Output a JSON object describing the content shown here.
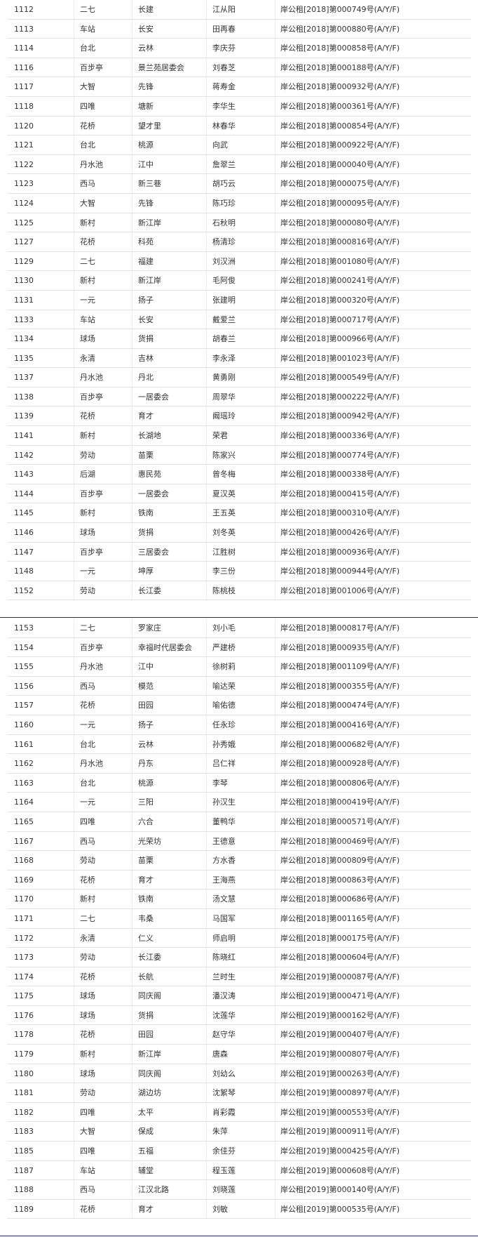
{
  "table_top": {
    "rows": [
      [
        "1112",
        "二七",
        "长建",
        "江从阳",
        "岸公租[2018]第000749号(A/Y/F)"
      ],
      [
        "1113",
        "车站",
        "长安",
        "田再春",
        "岸公租[2018]第000880号(A/Y/F)"
      ],
      [
        "1114",
        "台北",
        "云林",
        "李庆芬",
        "岸公租[2018]第000858号(A/Y/F)"
      ],
      [
        "1116",
        "百步亭",
        "景兰苑居委会",
        "刘春芝",
        "岸公租[2018]第000188号(A/Y/F)"
      ],
      [
        "1117",
        "大智",
        "先锋",
        "蒋寿金",
        "岸公租[2018]第000932号(A/Y/F)"
      ],
      [
        "1118",
        "四唯",
        "塘新",
        "李华生",
        "岸公租[2018]第000361号(A/Y/F)"
      ],
      [
        "1120",
        "花桥",
        "望才里",
        "林春华",
        "岸公租[2018]第000854号(A/Y/F)"
      ],
      [
        "1121",
        "台北",
        "桃源",
        "向武",
        "岸公租[2018]第000922号(A/Y/F)"
      ],
      [
        "1122",
        "丹水池",
        "江中",
        "詹翠兰",
        "岸公租[2018]第000040号(A/Y/F)"
      ],
      [
        "1123",
        "西马",
        "新三巷",
        "胡巧云",
        "岸公租[2018]第000075号(A/Y/F)"
      ],
      [
        "1124",
        "大智",
        "先锋",
        "陈巧珍",
        "岸公租[2018]第000095号(A/Y/F)"
      ],
      [
        "1125",
        "新村",
        "新江岸",
        "石秋明",
        "岸公租[2018]第000080号(A/Y/F)"
      ],
      [
        "1127",
        "花桥",
        "科苑",
        "杨清珍",
        "岸公租[2018]第000816号(A/Y/F)"
      ],
      [
        "1129",
        "二七",
        "福建",
        "刘汉洲",
        "岸公租[2018]第001080号(A/Y/F)"
      ],
      [
        "1130",
        "新村",
        "新江岸",
        "毛阿俊",
        "岸公租[2018]第000241号(A/Y/F)"
      ],
      [
        "1131",
        "一元",
        "扬子",
        "张建明",
        "岸公租[2018]第000320号(A/Y/F)"
      ],
      [
        "1133",
        "车站",
        "长安",
        "戴爱兰",
        "岸公租[2018]第000717号(A/Y/F)"
      ],
      [
        "1134",
        "球场",
        "货捐",
        "胡春兰",
        "岸公租[2018]第000966号(A/Y/F)"
      ],
      [
        "1135",
        "永清",
        "吉林",
        "李永泽",
        "岸公租[2018]第001023号(A/Y/F)"
      ],
      [
        "1137",
        "丹水池",
        "丹北",
        "黄勇刚",
        "岸公租[2018]第000549号(A/Y/F)"
      ],
      [
        "1138",
        "百步亭",
        "一居委会",
        "周翠华",
        "岸公租[2018]第000222号(A/Y/F)"
      ],
      [
        "1139",
        "花桥",
        "育才",
        "阚瑶玲",
        "岸公租[2018]第000942号(A/Y/F)"
      ],
      [
        "1141",
        "新村",
        "长湖地",
        "荣君",
        "岸公租[2018]第000336号(A/Y/F)"
      ],
      [
        "1142",
        "劳动",
        "苗栗",
        "陈家兴",
        "岸公租[2018]第000774号(A/Y/F)"
      ],
      [
        "1143",
        "后湖",
        "惠民苑",
        "曾冬梅",
        "岸公租[2018]第000338号(A/Y/F)"
      ],
      [
        "1144",
        "百步亭",
        "一居委会",
        "夏汉英",
        "岸公租[2018]第000415号(A/Y/F)"
      ],
      [
        "1145",
        "新村",
        "铁南",
        "王五英",
        "岸公租[2018]第000310号(A/Y/F)"
      ],
      [
        "1146",
        "球场",
        "货捐",
        "刘冬英",
        "岸公租[2018]第000426号(A/Y/F)"
      ],
      [
        "1147",
        "百步亭",
        "三居委会",
        "江胜树",
        "岸公租[2018]第000936号(A/Y/F)"
      ],
      [
        "1148",
        "一元",
        "坤厚",
        "李三份",
        "岸公租[2018]第000944号(A/Y/F)"
      ],
      [
        "1152",
        "劳动",
        "长江委",
        "陈桃枝",
        "岸公租[2018]第001006号(A/Y/F)"
      ]
    ]
  },
  "table_bottom": {
    "rows": [
      [
        "1153",
        "二七",
        "罗家庄",
        "刘小毛",
        "岸公租[2018]第000817号(A/Y/F)"
      ],
      [
        "1154",
        "百步亭",
        "幸福时代居委会",
        "严建桥",
        "岸公租[2018]第000935号(A/Y/F)"
      ],
      [
        "1155",
        "丹水池",
        "江中",
        "徐树莉",
        "岸公租[2018]第001109号(A/Y/F)"
      ],
      [
        "1156",
        "西马",
        "模范",
        "喻达荣",
        "岸公租[2018]第000355号(A/Y/F)"
      ],
      [
        "1157",
        "花桥",
        "田园",
        "喻佑德",
        "岸公租[2018]第000474号(A/Y/F)"
      ],
      [
        "1160",
        "一元",
        "扬子",
        "任永珍",
        "岸公租[2018]第000416号(A/Y/F)"
      ],
      [
        "1161",
        "台北",
        "云林",
        "孙秀娥",
        "岸公租[2018]第000682号(A/Y/F)"
      ],
      [
        "1162",
        "丹水池",
        "丹东",
        "吕仁祥",
        "岸公租[2018]第000928号(A/Y/F)"
      ],
      [
        "1163",
        "台北",
        "桃源",
        "李琴",
        "岸公租[2018]第000806号(A/Y/F)"
      ],
      [
        "1164",
        "一元",
        "三阳",
        "孙汉生",
        "岸公租[2018]第000419号(A/Y/F)"
      ],
      [
        "1165",
        "四唯",
        "六合",
        "董鸭华",
        "岸公租[2018]第000571号(A/Y/F)"
      ],
      [
        "1167",
        "西马",
        "光荣坊",
        "王德意",
        "岸公租[2018]第000469号(A/Y/F)"
      ],
      [
        "1168",
        "劳动",
        "苗栗",
        "方水香",
        "岸公租[2018]第000809号(A/Y/F)"
      ],
      [
        "1169",
        "花桥",
        "育才",
        "王海燕",
        "岸公租[2018]第000863号(A/Y/F)"
      ],
      [
        "1170",
        "新村",
        "铁南",
        "汤文慧",
        "岸公租[2018]第000686号(A/Y/F)"
      ],
      [
        "1171",
        "二七",
        "韦桑",
        "马国军",
        "岸公租[2018]第001165号(A/Y/F)"
      ],
      [
        "1172",
        "永清",
        "仁义",
        "师启明",
        "岸公租[2018]第000175号(A/Y/F)"
      ],
      [
        "1173",
        "劳动",
        "长江委",
        "陈晓红",
        "岸公租[2018]第000604号(A/Y/F)"
      ],
      [
        "1174",
        "花桥",
        "长航",
        "兰时生",
        "岸公租[2019]第000087号(A/Y/F)"
      ],
      [
        "1175",
        "球场",
        "同庆阁",
        "潘汉涛",
        "岸公租[2019]第000471号(A/Y/F)"
      ],
      [
        "1176",
        "球场",
        "货捐",
        "沈莲华",
        "岸公租[2019]第000162号(A/Y/F)"
      ],
      [
        "1178",
        "花桥",
        "田园",
        "赵守华",
        "岸公租[2019]第000407号(A/Y/F)"
      ],
      [
        "1179",
        "新村",
        "新江岸",
        "唐森",
        "岸公租[2019]第000807号(A/Y/F)"
      ],
      [
        "1180",
        "球场",
        "同庆阁",
        "刘幼么",
        "岸公租[2019]第000263号(A/Y/F)"
      ],
      [
        "1181",
        "劳动",
        "湖边坊",
        "沈絮琴",
        "岸公租[2019]第000897号(A/Y/F)"
      ],
      [
        "1182",
        "四唯",
        "太平",
        "肖彩霞",
        "岸公租[2019]第000553号(A/Y/F)"
      ],
      [
        "1183",
        "大智",
        "保成",
        "朱萍",
        "岸公租[2019]第000911号(A/Y/F)"
      ],
      [
        "1185",
        "四唯",
        "五福",
        "余佳芬",
        "岸公租[2019]第000425号(A/Y/F)"
      ],
      [
        "1187",
        "车站",
        "辅堂",
        "程玉莲",
        "岸公租[2019]第000608号(A/Y/F)"
      ],
      [
        "1188",
        "西马",
        "江汉北路",
        "刘晓莲",
        "岸公租[2019]第000140号(A/Y/F)"
      ],
      [
        "1189",
        "花桥",
        "育才",
        "刘敏",
        "岸公租[2019]第000535号(A/Y/F)"
      ]
    ]
  },
  "colors": {
    "separator": "#1f2a78",
    "row_border": "#e3e3e3",
    "text": "#333333"
  }
}
